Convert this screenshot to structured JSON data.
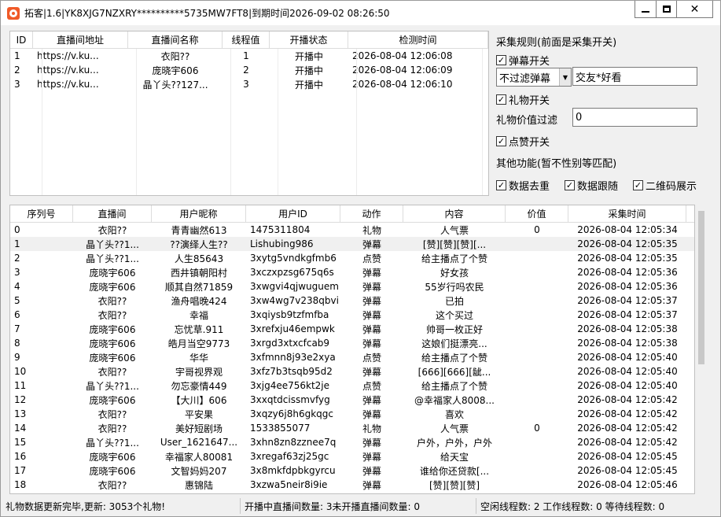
{
  "window": {
    "title": "拓客|1.6|YK8XJG7NZXRY**********5735MW7FT8|到期时间2026-09-02 08:26:50"
  },
  "room_table": {
    "headers": [
      "ID",
      "直播间地址",
      "直播间名称",
      "线程值",
      "开播状态",
      "检测时间"
    ],
    "rows": [
      [
        "1",
        "https://v.ku...",
        "衣阳??",
        "1",
        "开播中",
        "2026-08-04 12:06:08"
      ],
      [
        "2",
        "https://v.ku...",
        "庞晓宇606",
        "2",
        "开播中",
        "2026-08-04 12:06:09"
      ],
      [
        "3",
        "https://v.ku...",
        "晶丫头??127...",
        "3",
        "开播中",
        "2026-08-04 12:06:10"
      ]
    ]
  },
  "rules": {
    "title": "采集规则(前面是采集开关)",
    "danmu_switch": "弹幕开关",
    "danmu_filter_selected": "不过滤弹幕",
    "danmu_keyword": "交友*好看",
    "gift_switch": "礼物开关",
    "gift_value_label": "礼物价值过滤",
    "gift_value": "0",
    "like_switch": "点赞开关",
    "other_title": "其他功能(暂不性别等匹配)",
    "dedupe": "数据去重",
    "follow": "数据跟随",
    "qrcode": "二维码展示"
  },
  "data_table": {
    "headers": [
      "序列号",
      "直播间",
      "用户昵称",
      "用户ID",
      "动作",
      "内容",
      "价值",
      "采集时间"
    ],
    "rows": [
      [
        "0",
        "衣阳??",
        "青青幽然613",
        "1475311804",
        "礼物",
        "人气票",
        "0",
        "2026-08-04 12:05:34"
      ],
      [
        "1",
        "晶丫头??1...",
        "??演绎人生??",
        "Lishubing986",
        "弹幕",
        "[赞][赞][赞][...",
        "",
        "2026-08-04 12:05:35"
      ],
      [
        "2",
        "晶丫头??1...",
        "人生85643",
        "3xytg5vndkgfmb6",
        "点赞",
        "给主播点了个赞",
        "",
        "2026-08-04 12:05:35"
      ],
      [
        "3",
        "庞晓宇606",
        "西井镇朝阳村",
        "3xczxpzsg675q6s",
        "弹幕",
        "好女孩",
        "",
        "2026-08-04 12:05:36"
      ],
      [
        "4",
        "庞晓宇606",
        "顺其自然71859",
        "3xwgvi4qjwuguem",
        "弹幕",
        "55岁行吗农民",
        "",
        "2026-08-04 12:05:36"
      ],
      [
        "5",
        "衣阳??",
        "渔舟唱晚424",
        "3xw4wg7v238qbvi",
        "弹幕",
        "已拍",
        "",
        "2026-08-04 12:05:37"
      ],
      [
        "6",
        "衣阳??",
        "幸福",
        "3xqiysb9tzfmfba",
        "弹幕",
        "这个买过",
        "",
        "2026-08-04 12:05:37"
      ],
      [
        "7",
        "庞晓宇606",
        "忘忧草.911",
        "3xrefxju46empwk",
        "弹幕",
        "帅哥一枚正好",
        "",
        "2026-08-04 12:05:38"
      ],
      [
        "8",
        "庞晓宇606",
        "皓月当空9773",
        "3xrgd3xtxcfcab9",
        "弹幕",
        "这娘们挺漂亮...",
        "",
        "2026-08-04 12:05:38"
      ],
      [
        "9",
        "庞晓宇606",
        "华华",
        "3xfmnn8j93e2xya",
        "点赞",
        "给主播点了个赞",
        "",
        "2026-08-04 12:05:40"
      ],
      [
        "10",
        "衣阳??",
        "宇哥视界观",
        "3xfz7b3tsqb95d2",
        "弹幕",
        "[666][666][龇...",
        "",
        "2026-08-04 12:05:40"
      ],
      [
        "11",
        "晶丫头??1...",
        "勿忘豪情449",
        "3xjg4ee756kt2je",
        "点赞",
        "给主播点了个赞",
        "",
        "2026-08-04 12:05:40"
      ],
      [
        "12",
        "庞晓宇606",
        "【大川】606",
        "3xxqtdcissmvfyg",
        "弹幕",
        "@幸福家人8008...",
        "",
        "2026-08-04 12:05:42"
      ],
      [
        "13",
        "衣阳??",
        "平安果",
        "3xqzy6j8h6gkqgc",
        "弹幕",
        "喜欢",
        "",
        "2026-08-04 12:05:42"
      ],
      [
        "14",
        "衣阳??",
        "美好短剧场",
        "1533855077",
        "礼物",
        "人气票",
        "0",
        "2026-08-04 12:05:42"
      ],
      [
        "15",
        "晶丫头??1...",
        "User_1621647...",
        "3xhn8zn8zznee7q",
        "弹幕",
        "户外，户外，户外",
        "",
        "2026-08-04 12:05:42"
      ],
      [
        "16",
        "庞晓宇606",
        "幸福家人80081",
        "3xregaf63zj25gc",
        "弹幕",
        "给天宝",
        "",
        "2026-08-04 12:05:45"
      ],
      [
        "17",
        "庞晓宇606",
        "文智妈妈207",
        "3x8mkfdpbkgyrcu",
        "弹幕",
        "谁给你还贷款[...",
        "",
        "2026-08-04 12:05:45"
      ],
      [
        "18",
        "衣阳??",
        "惠锦陆",
        "3xzwa5neir8i9ie",
        "弹幕",
        "[赞][赞][赞]",
        "",
        "2026-08-04 12:05:46"
      ]
    ]
  },
  "status": {
    "gift_update": "礼物数据更新完毕,更新: 3053个礼物!",
    "rooms": "开播中直播间数量: 3未开播直播间数量: 0",
    "threads": "空闲线程数: 2  工作线程数: 0 等待线程数: 0"
  }
}
